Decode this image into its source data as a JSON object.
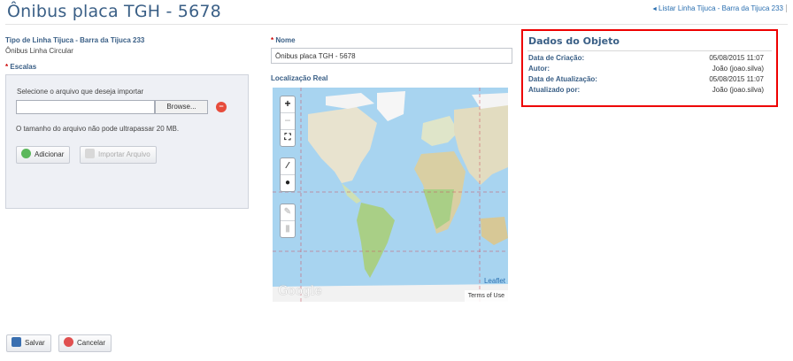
{
  "header": {
    "title": "Ônibus placa TGH - 5678",
    "back_link": "Listar Linha Tijuca - Barra da Tijuca 233"
  },
  "left": {
    "tipo_label": "Tipo de Linha Tijuca - Barra da Tijuca 233",
    "tipo_value": "Ônibus Linha Circular",
    "escalas_label": "Escalas",
    "select_file_text": "Selecione o arquivo que deseja importar",
    "browse_label": "Browse...",
    "size_note": "O tamanho do arquivo não pode ultrapassar 20 MB.",
    "add_button": "Adicionar",
    "import_button": "Importar Arquivo"
  },
  "middle": {
    "nome_label": "Nome",
    "nome_value": "Ônibus placa TGH - 5678",
    "localizacao_label": "Localização Real",
    "map": {
      "zoom_in": "+",
      "zoom_out": "−",
      "leaflet_label": "Leaflet",
      "terms_label": "Terms of Use",
      "google_label": "Google"
    }
  },
  "object_data": {
    "title": "Dados do Objeto",
    "rows": [
      {
        "label": "Data de Criação:",
        "value": "05/08/2015 11:07"
      },
      {
        "label": "Autor:",
        "value": "João (joao.silva)"
      },
      {
        "label": "Data de Atualização:",
        "value": "05/08/2015 11:07"
      },
      {
        "label": "Atualizado por:",
        "value": "João (joao.silva)"
      }
    ]
  },
  "footer": {
    "save_button": "Salvar",
    "cancel_button": "Cancelar"
  },
  "colors": {
    "accent": "#3a5f86",
    "link": "#2a6fb0",
    "highlight_border": "#ee0000",
    "map_water": "#a8d4f0"
  }
}
